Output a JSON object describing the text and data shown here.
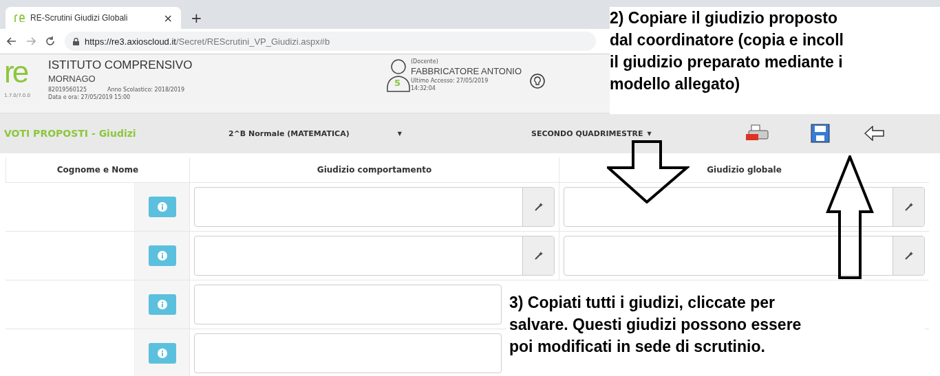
{
  "browser": {
    "tab_title": "RE-Scrutini Giudizi Globali",
    "tab_close": "×",
    "new_tab": "+",
    "url_host": "https://re3.axioscloud.it",
    "url_path": "/Secret/REScrutini_VP_Giudizi.aspx#b"
  },
  "header": {
    "logo": "re",
    "version": "1.7.0/7.0.0",
    "school": "ISTITUTO COMPRENSIVO",
    "town": "MORNAGO",
    "code": "82019560125",
    "year": "Anno Scolastico: 2018/2019",
    "datetime": "Data e ora: 27/05/2019 15:00",
    "user_badge": "5",
    "role": "(Docente)",
    "user": "FABBRICATORE ANTONIO",
    "last_access": "Ultimo Accesso: 27/05/2019",
    "last_time": "14:32:04"
  },
  "toolbar": {
    "title": "VOTI PROPOSTI - Giudizi",
    "class_select": "2^B Normale (MATEMATICA)",
    "period_select": "SECONDO QUADRIMESTRE",
    "caret": "▼"
  },
  "table": {
    "columns": [
      "Cognome e Nome",
      "Giudizio comportamento",
      "Giudizio globale"
    ],
    "rows": [
      {
        "covered": false
      },
      {
        "covered": false
      },
      {
        "covered": true
      },
      {
        "covered": true
      }
    ]
  },
  "annotations": [
    {
      "lines": [
        "2) Copiare il giudizio proposto",
        "dal coordinatore (copia e incoll",
        "il giudizio preparato mediante i",
        "modello allegato)"
      ]
    },
    {
      "lines": [
        "3) Copiati tutti i giudizi, cliccate per",
        "salvare. Questi giudizi possono essere",
        "poi modificati in sede di scrutinio."
      ]
    }
  ]
}
